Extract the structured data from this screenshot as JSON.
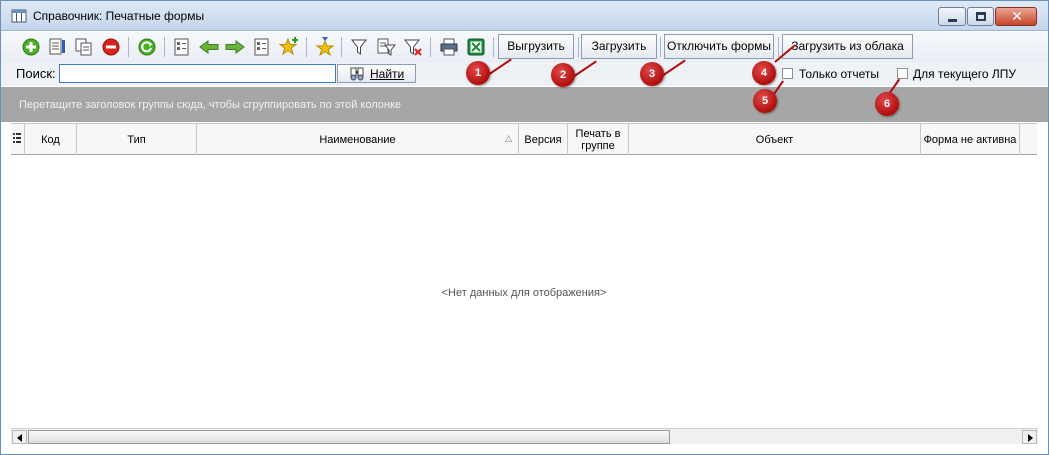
{
  "window": {
    "title": "Справочник: Печатные формы",
    "close_glyph": "✕"
  },
  "toolbar": {
    "icons": [
      "add-icon",
      "edit-icon",
      "copy-icon",
      "delete-icon",
      "refresh-icon",
      "group-icon",
      "arrow-left-icon",
      "arrow-right-icon",
      "list-icon",
      "star-add-icon",
      "star-icon",
      "filter-icon",
      "filter-edit-icon",
      "filter-clear-icon",
      "print-icon",
      "excel-icon"
    ],
    "export_label": "Выгрузить",
    "import_label": "Загрузить",
    "disable_forms_label": "Отключить формы",
    "cloud_import_label": "Загрузить из облака"
  },
  "search": {
    "label": "Поиск:",
    "value": "",
    "find_label": "Найти"
  },
  "filters": {
    "only_reports_label": "Только отчеты",
    "only_reports_checked": false,
    "current_lpu_label": "Для текущего ЛПУ",
    "current_lpu_checked": false
  },
  "group_panel": {
    "hint": "Перетащите заголовок группы сюда, чтобы сгруппировать по этой колонке"
  },
  "grid": {
    "columns": [
      "Код",
      "Тип",
      "Наименование",
      "Версия",
      "Печать в группе",
      "Объект",
      "Форма не активна"
    ],
    "sorted_column": "Наименование",
    "sort_glyph": "△",
    "empty_text": "<Нет данных для отображения>"
  },
  "markers": [
    "1",
    "2",
    "3",
    "4",
    "5",
    "6"
  ],
  "colors": {
    "accent": "#3d7bc4",
    "marker": "#b00d0d",
    "group_panel": "#a6a6a6"
  }
}
